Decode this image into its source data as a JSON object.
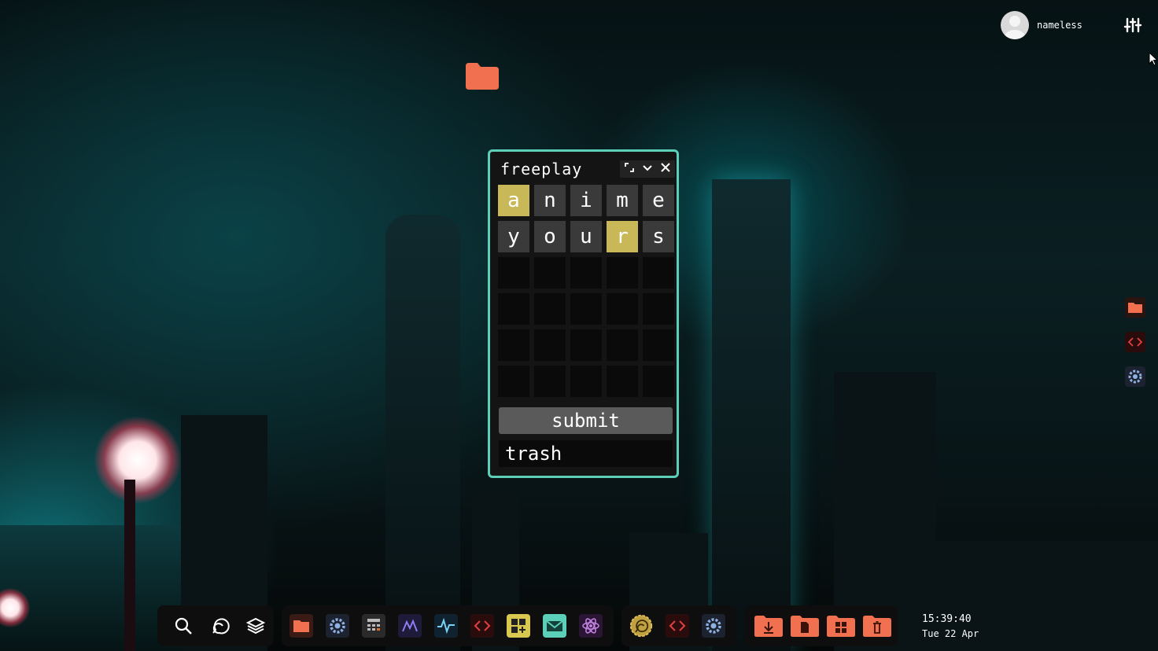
{
  "topbar": {
    "username": "nameless"
  },
  "window": {
    "title": "freeplay",
    "grid": [
      [
        {
          "l": "a",
          "s": "yellow"
        },
        {
          "l": "n",
          "s": "gray"
        },
        {
          "l": "i",
          "s": "gray"
        },
        {
          "l": "m",
          "s": "gray"
        },
        {
          "l": "e",
          "s": "gray"
        }
      ],
      [
        {
          "l": "y",
          "s": "gray"
        },
        {
          "l": "o",
          "s": "gray"
        },
        {
          "l": "u",
          "s": "gray"
        },
        {
          "l": "r",
          "s": "yellow"
        },
        {
          "l": "s",
          "s": "gray"
        }
      ],
      [
        {
          "l": "",
          "s": "empty"
        },
        {
          "l": "",
          "s": "empty"
        },
        {
          "l": "",
          "s": "empty"
        },
        {
          "l": "",
          "s": "empty"
        },
        {
          "l": "",
          "s": "empty"
        }
      ],
      [
        {
          "l": "",
          "s": "empty"
        },
        {
          "l": "",
          "s": "empty"
        },
        {
          "l": "",
          "s": "empty"
        },
        {
          "l": "",
          "s": "empty"
        },
        {
          "l": "",
          "s": "empty"
        }
      ],
      [
        {
          "l": "",
          "s": "empty"
        },
        {
          "l": "",
          "s": "empty"
        },
        {
          "l": "",
          "s": "empty"
        },
        {
          "l": "",
          "s": "empty"
        },
        {
          "l": "",
          "s": "empty"
        }
      ],
      [
        {
          "l": "",
          "s": "empty"
        },
        {
          "l": "",
          "s": "empty"
        },
        {
          "l": "",
          "s": "empty"
        },
        {
          "l": "",
          "s": "empty"
        },
        {
          "l": "",
          "s": "empty"
        }
      ]
    ],
    "submit_label": "submit",
    "trash_label": "trash"
  },
  "taskbar": {
    "time": "15:39:40",
    "date": "Tue 22 Apr"
  },
  "colors": {
    "accent": "#5ccfb8",
    "yellow": "#c9b858",
    "gray": "#3a3a3a",
    "folder": "#f07050"
  }
}
